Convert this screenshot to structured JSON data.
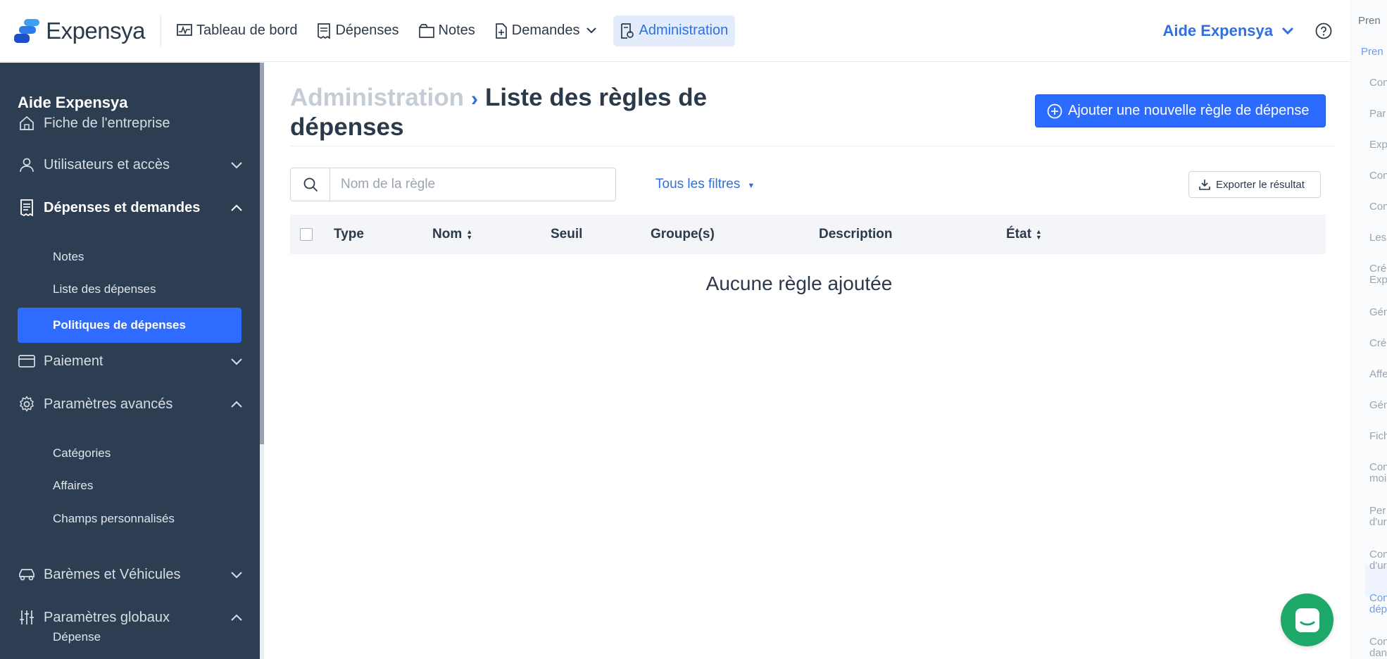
{
  "app": {
    "brand": "Expensya",
    "nav": [
      {
        "label": "Tableau de bord",
        "icon": "dashboard-icon"
      },
      {
        "label": "Dépenses",
        "icon": "receipt-icon"
      },
      {
        "label": "Notes",
        "icon": "folder-icon"
      },
      {
        "label": "Demandes",
        "icon": "document-plus-icon"
      },
      {
        "label": "Administration",
        "icon": "admin-icon",
        "active": true
      }
    ],
    "user_menu": "Aide Expensya"
  },
  "sidebar": {
    "company": "Aide Expensya",
    "sections": [
      {
        "label": "Fiche de l'entreprise",
        "icon": "home-icon"
      },
      {
        "label": "Utilisateurs et accès",
        "icon": "user-icon"
      },
      {
        "label": "Dépenses et demandes",
        "icon": "receipt-icon",
        "expanded": true
      },
      {
        "label": "Paiement",
        "icon": "card-icon"
      },
      {
        "label": "Paramètres avancés",
        "icon": "gear-icon",
        "expanded": true
      },
      {
        "label": "Barèmes et Véhicules",
        "icon": "car-icon"
      },
      {
        "label": "Paramètres globaux",
        "icon": "sliders-icon",
        "expanded": true
      }
    ],
    "sub_expenses": [
      "Notes",
      "Liste des dépenses",
      "Politiques de dépenses"
    ],
    "sub_advanced": [
      "Catégories",
      "Affaires",
      "Champs personnalisés"
    ],
    "sub_global": [
      "Dépense"
    ]
  },
  "page": {
    "breadcrumb_parent": "Administration",
    "breadcrumb_current": "Liste des règles de dépenses",
    "add_button": "Ajouter une nouvelle règle de dépense",
    "search_placeholder": "Nom de la règle",
    "filters_label": "Tous les filtres",
    "export_label": "Exporter le résultat",
    "columns": [
      "Type",
      "Nom",
      "Seuil",
      "Groupe(s)",
      "Description",
      "État"
    ],
    "empty_message": "Aucune règle ajoutée"
  },
  "help_panel": {
    "items": [
      "Pren",
      "Pren",
      "Con",
      "Par",
      "Exp",
      "Con",
      "Con",
      "Les",
      "Cré Exp",
      "Gén",
      "Cré",
      "Affe",
      "Gén",
      "Fich",
      "Con moi",
      "Per d'ur",
      "Con d'ur",
      "Con dép",
      "Con dan"
    ]
  },
  "colors": {
    "accent": "#2f6bff",
    "sidebar_bg": "#2e3e52",
    "chat": "#1ea86a"
  }
}
